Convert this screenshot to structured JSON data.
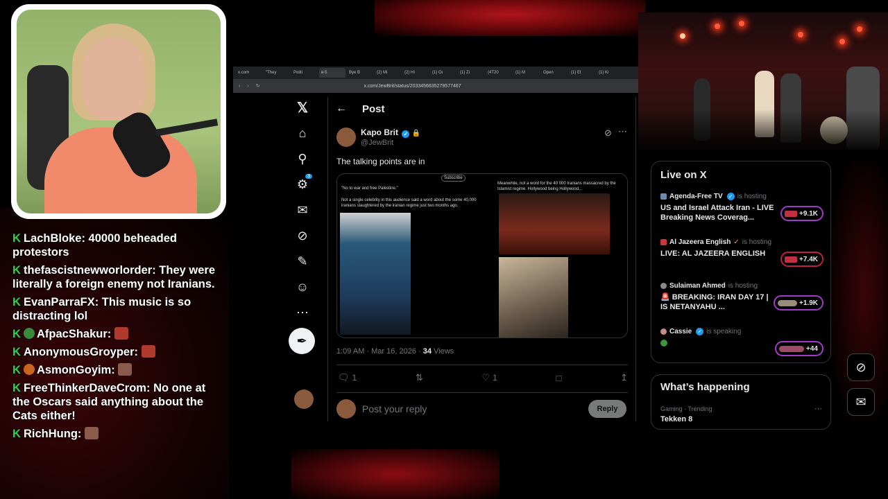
{
  "browser": {
    "tabs": [
      "x.com",
      "\"They",
      "Politi",
      "ᴃ ß",
      "Bye B",
      "(2) Mi",
      "(2) Hí",
      "(1) Oı",
      "(1) Zi",
      "(4T20",
      "(1) M",
      "Open",
      "(1) Et",
      "(1) Ki"
    ],
    "url": "x.com/JewBrit/status/2033456635279577467"
  },
  "x": {
    "page_title": "Post",
    "author_name": "Kapo Brit",
    "author_handle": "@JewBrit",
    "post_text": "The talking points are in",
    "quoted_left_header": "\"No to war and free Palestine.\"",
    "quoted_left_body": "Not a single celebrity in this audience said a word about the some 40,000 iranians slaughtered by the iranian regime just two months ago.",
    "quoted_left_subscribe": "Subscribe",
    "quoted_right_body": "Meanwhile, not a word for the 40 000 Iranians massacred by the Islamist regime. Hollywood being Hollywood...",
    "timestamp": "1:09 AM · Mar 16, 2026 ·",
    "views_count": "34",
    "views_label": " Views",
    "reply_count": "1",
    "like_count": "1",
    "reply_placeholder": "Post your reply",
    "reply_button": "Reply",
    "notification_badge": "3"
  },
  "live": {
    "title": "Live on X",
    "items": [
      {
        "host": "Agenda-Free TV",
        "status": "is hosting",
        "title": "US and Israel Attack Iran - LIVE Breaking News Coverag...",
        "count": "+9.1K"
      },
      {
        "host": "Al Jazeera English",
        "status": "is hosting",
        "title": "LIVE: AL JAZEERA ENGLISH",
        "count": "+7.4K"
      },
      {
        "host": "Sulaiman Ahmed",
        "status": "is hosting",
        "title": "🚨 BREAKING: IRAN DAY 17 | IS NETANYAHU ...",
        "count": "+1.9K"
      },
      {
        "host": "Cassie",
        "status": "is speaking",
        "title": "",
        "count": "+44"
      }
    ]
  },
  "happening": {
    "title": "What’s happening",
    "trend_meta": "Gaming · Trending",
    "trend_name": "Tekken 8"
  },
  "chat": [
    {
      "user": "LachBloke:",
      "text": " 40000 beheaded protestors"
    },
    {
      "user": "thefascistnewworlorder:",
      "text": " They were literally a foreign enemy not Iranians."
    },
    {
      "user": "EvanParraFX:",
      "text": " This music is so distracting lol"
    },
    {
      "user": "AfpacShakur:",
      "text": ""
    },
    {
      "user": "AnonymousGroyper:",
      "text": ""
    },
    {
      "user": "AsmonGoyim:",
      "text": ""
    },
    {
      "user": "FreeThinkerDaveCrom:",
      "text": " No one at the Oscars said anything about the Cats either!"
    },
    {
      "user": "RichHung:",
      "text": ""
    }
  ],
  "icons": {
    "x_logo": "X",
    "home": "⌂",
    "search": "⌕",
    "bell": "🔔",
    "mail": "✉",
    "grok": "⊘",
    "more": "···"
  },
  "colors": {
    "accent": "#1d9bf0",
    "chat_badge": "#2fd44a",
    "live_ring": "#a03ac8"
  }
}
